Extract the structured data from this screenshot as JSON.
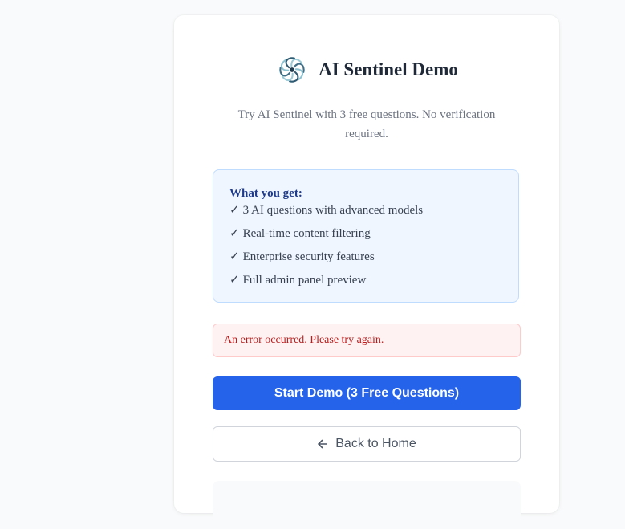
{
  "app": {
    "title": "AI Sentinel Demo",
    "subtitle": "Try AI Sentinel with 3 free questions. No verification required.",
    "logo_icon": "aperture-swirl-logo"
  },
  "features": {
    "heading": "What you get:",
    "check_glyph": "✓",
    "items": [
      {
        "label": "3 AI questions with advanced models"
      },
      {
        "label": "Real-time content filtering"
      },
      {
        "label": "Enterprise security features"
      },
      {
        "label": "Full admin panel preview"
      }
    ]
  },
  "error": {
    "message": "An error occurred. Please try again."
  },
  "actions": {
    "start_label": "Start Demo (3 Free Questions)",
    "back_label": "Back to Home",
    "back_icon": "arrow-left-icon"
  },
  "colors": {
    "primary": "#2563eb",
    "features_bg": "#eff6ff",
    "features_border": "#bfdbfe",
    "error_bg": "#fef2f2",
    "error_text": "#b91c1c",
    "heading_blue": "#1e3a8a"
  }
}
